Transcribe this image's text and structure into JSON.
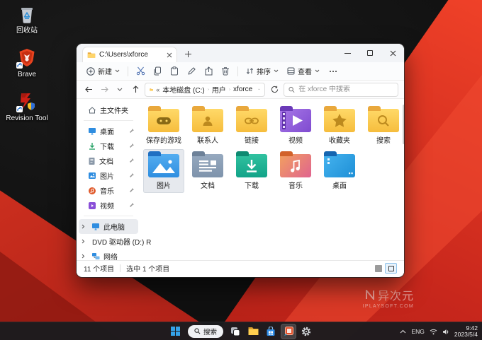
{
  "desktop": {
    "icons": [
      {
        "label": "回收站"
      },
      {
        "label": "Brave"
      },
      {
        "label": "Revision Tool"
      }
    ]
  },
  "window": {
    "tab_title": "C:\\Users\\xforce",
    "toolbar": {
      "new_label": "新建",
      "sort_label": "排序",
      "view_label": "查看"
    },
    "address": {
      "overflow": "«",
      "crumbs": [
        "本地磁盘 (C:)",
        "用户",
        "xforce"
      ]
    },
    "search_placeholder": "在 xforce 中搜索",
    "sidebar": {
      "home_label": "主文件夹",
      "pinned": [
        {
          "name": "桌面"
        },
        {
          "name": "下载"
        },
        {
          "name": "文档"
        },
        {
          "name": "图片"
        },
        {
          "name": "音乐"
        },
        {
          "name": "视频"
        }
      ],
      "tree": [
        {
          "name": "此电脑"
        },
        {
          "name": "DVD 驱动器 (D:) R"
        },
        {
          "name": "网络"
        }
      ]
    },
    "files": [
      {
        "name": "保存的游戏"
      },
      {
        "name": "联系人"
      },
      {
        "name": "链接"
      },
      {
        "name": "视频"
      },
      {
        "name": "收藏夹"
      },
      {
        "name": "搜索"
      },
      {
        "name": "图片",
        "selected": true
      },
      {
        "name": "文档"
      },
      {
        "name": "下载"
      },
      {
        "name": "音乐"
      },
      {
        "name": "桌面"
      }
    ],
    "statusbar": {
      "items": "11 个项目",
      "selected": "选中 1 个项目"
    }
  },
  "taskbar": {
    "search_label": "搜索",
    "tray": {
      "lang": "ENG",
      "time": "9:42",
      "date": "2023/5/4"
    }
  },
  "watermark": {
    "name": "异次元",
    "site": "IPLAYSOFT.COM"
  },
  "colors": {
    "accent_red": "#d22c1e",
    "folder_yellow": "#ffd45e",
    "selection": "#e6e9ee"
  }
}
